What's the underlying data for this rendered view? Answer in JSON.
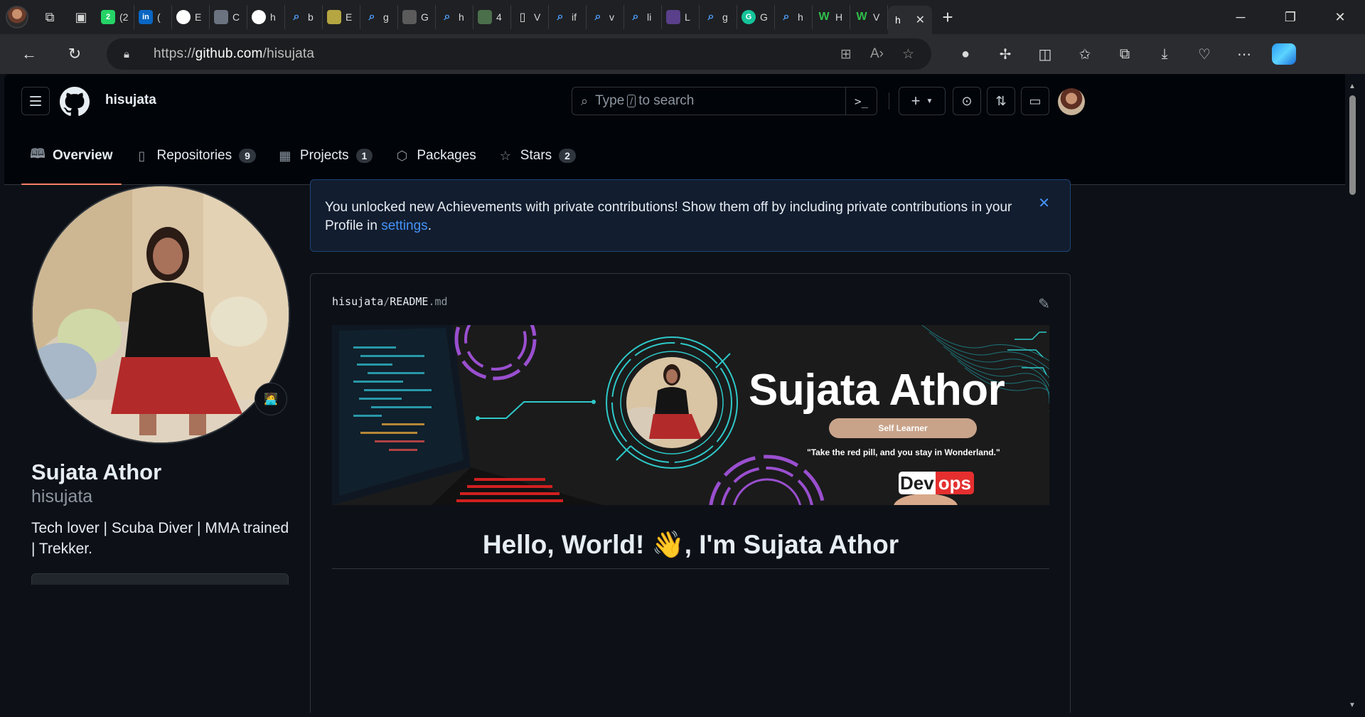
{
  "browser": {
    "tabs": [
      {
        "icon": "whatsapp-icon",
        "title": "(2",
        "color": "#25d366",
        "badge": "2"
      },
      {
        "icon": "linkedin-icon",
        "title": "(",
        "color": "#0a66c2",
        "badge": "in"
      },
      {
        "icon": "github-icon",
        "title": "E",
        "color": "#ffffff",
        "badge": ""
      },
      {
        "icon": "openai-icon",
        "title": "C",
        "color": "#6b7280",
        "badge": ""
      },
      {
        "icon": "github-icon",
        "title": "h",
        "color": "#ffffff",
        "badge": ""
      },
      {
        "icon": "search-icon",
        "title": "b",
        "color": "#1f2023",
        "badge": ""
      },
      {
        "icon": "bucket-icon",
        "title": "E",
        "color": "#b5a642",
        "badge": ""
      },
      {
        "icon": "search-icon",
        "title": "g",
        "color": "#1f2023",
        "badge": ""
      },
      {
        "icon": "mg-icon",
        "title": "G",
        "color": "#5b5b5b",
        "badge": ""
      },
      {
        "icon": "search-icon",
        "title": "h",
        "color": "#1f2023",
        "badge": ""
      },
      {
        "icon": "w3-icon",
        "title": "4",
        "color": "#4b6e4b",
        "badge": ""
      },
      {
        "icon": "file-icon",
        "title": "V",
        "color": "#1f2023",
        "badge": ""
      },
      {
        "icon": "search-icon",
        "title": "if",
        "color": "#1f2023",
        "badge": ""
      },
      {
        "icon": "search-icon",
        "title": "v",
        "color": "#1f2023",
        "badge": ""
      },
      {
        "icon": "search-icon",
        "title": "li",
        "color": "#1f2023",
        "badge": ""
      },
      {
        "icon": "stripes-icon",
        "title": "L",
        "color": "#5a3f8a",
        "badge": ""
      },
      {
        "icon": "bing-search-icon",
        "title": "g",
        "color": "#1f2023",
        "badge": ""
      },
      {
        "icon": "grammarly-icon",
        "title": "G",
        "color": "#15c39a",
        "badge": "G"
      },
      {
        "icon": "bing-search-icon",
        "title": "h",
        "color": "#1f2023",
        "badge": ""
      },
      {
        "icon": "w-icon",
        "title": "H",
        "color": "#1f2023",
        "badge": "W"
      },
      {
        "icon": "w-icon",
        "title": "V",
        "color": "#1f2023",
        "badge": "W"
      }
    ],
    "active_tab_title": "h",
    "url_prefix": "https://",
    "url_host": "github.com",
    "url_path": "/hisujata"
  },
  "github": {
    "username": "hisujata",
    "search_text_before": "Type",
    "search_key": "/",
    "search_text_after": "to search",
    "plus_label": "+",
    "nav_tabs": [
      {
        "label": "Overview",
        "icon": "book-icon",
        "count": ""
      },
      {
        "label": "Repositories",
        "icon": "repo-icon",
        "count": "9"
      },
      {
        "label": "Projects",
        "icon": "table-icon",
        "count": "1"
      },
      {
        "label": "Packages",
        "icon": "package-icon",
        "count": ""
      },
      {
        "label": "Stars",
        "icon": "star-icon",
        "count": "2"
      }
    ]
  },
  "profile": {
    "name": "Sujata Athor",
    "login": "hisujata",
    "bio": "Tech lover | Scuba Diver | MMA trained | Trekker."
  },
  "flash": {
    "message": "You unlocked new Achievements with private contributions! Show them off by including private contributions in your Profile in",
    "link": "settings",
    "after": "."
  },
  "readme": {
    "owner": "hisujata",
    "separator": "/",
    "file": "README",
    "ext": ".md",
    "banner_name": "Sujata Athor",
    "banner_pill": "Self Learner",
    "banner_quote": "\"Take the red pill, and you stay in Wonderland.\"",
    "devops_a": "Dev",
    "devops_b": "ops",
    "heading": "Hello, World! 👋, I'm Sujata Athor"
  },
  "colors": {
    "accent_blue": "#4493f8",
    "tab_underline": "#f78166",
    "page_bg": "#0d1117",
    "header_bg": "#010409",
    "border": "#30363d"
  }
}
